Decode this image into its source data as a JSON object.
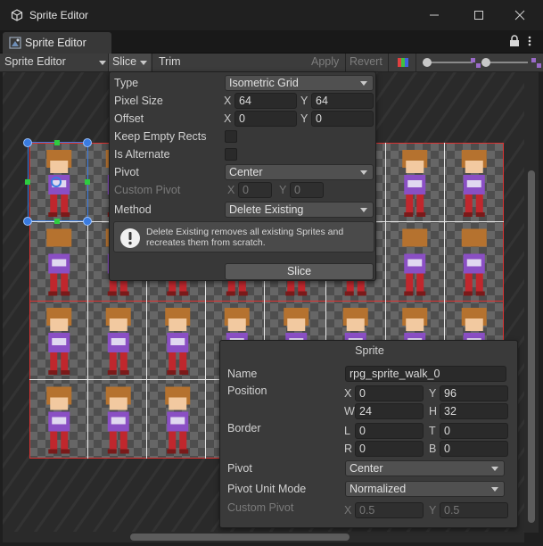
{
  "window": {
    "title": "Sprite Editor"
  },
  "tab": {
    "label": "Sprite Editor"
  },
  "toolbar": {
    "mode_label": "Sprite Editor",
    "slice_label": "Slice",
    "trim_label": "Trim",
    "apply_label": "Apply",
    "revert_label": "Revert"
  },
  "slice_panel": {
    "type_label": "Type",
    "type_value": "Isometric Grid",
    "pixel_size_label": "Pixel Size",
    "pixel_x": "64",
    "pixel_y": "64",
    "offset_label": "Offset",
    "offset_x": "0",
    "offset_y": "0",
    "keep_empty_label": "Keep Empty Rects",
    "is_alternate_label": "Is Alternate",
    "pivot_label": "Pivot",
    "pivot_value": "Center",
    "custom_pivot_label": "Custom Pivot",
    "custom_x": "0",
    "custom_y": "0",
    "method_label": "Method",
    "method_value": "Delete Existing",
    "help_text": "Delete Existing removes all existing Sprites and recreates them from scratch.",
    "slice_button": "Slice",
    "x_label": "X",
    "y_label": "Y"
  },
  "sprite_panel": {
    "title": "Sprite",
    "name_label": "Name",
    "name_value": "rpg_sprite_walk_0",
    "position_label": "Position",
    "x_label": "X",
    "x_value": "0",
    "y_label": "Y",
    "y_value": "96",
    "w_label": "W",
    "w_value": "24",
    "h_label": "H",
    "h_value": "32",
    "border_label": "Border",
    "l_label": "L",
    "l_value": "0",
    "t_label": "T",
    "t_value": "0",
    "r_label": "R",
    "r_value": "0",
    "b_label": "B",
    "b_value": "0",
    "pivot_label": "Pivot",
    "pivot_value": "Center",
    "pivot_unit_label": "Pivot Unit Mode",
    "pivot_unit_value": "Normalized",
    "custom_pivot_label": "Custom Pivot",
    "cp_x_label": "X",
    "cp_x_value": "0.5",
    "cp_y_label": "Y",
    "cp_y_value": "0.5"
  },
  "colors": {
    "accent": "#3a7be0",
    "grid_line": "#dd3333",
    "selection_handle": "#2ecc40",
    "hair": "#b5722f",
    "shirt": "#8a4fc4",
    "pants": "#c0272d",
    "skin": "#f2c9a0"
  },
  "icons": {
    "app": "unity-cube-icon",
    "tab": "sprite-editor-icon",
    "lock": "lock-icon",
    "menu": "kebab-menu-icon",
    "help": "info-exclamation-icon",
    "color_channel": "rgb-channel-icon"
  }
}
